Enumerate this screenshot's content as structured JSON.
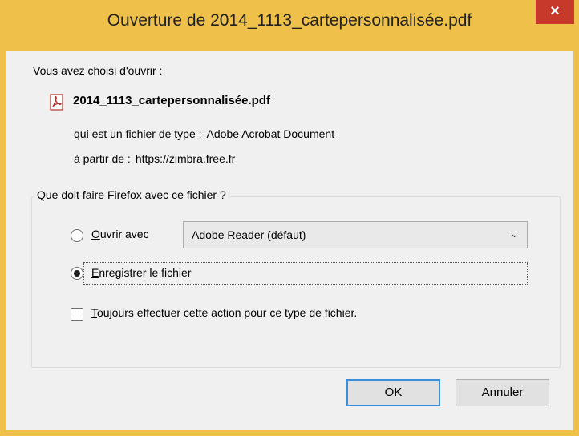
{
  "window": {
    "title": "Ouverture de 2014_1113_cartepersonnalisée.pdf",
    "close_label": "×"
  },
  "dialog": {
    "intro": "Vous avez choisi d'ouvrir :",
    "file_name": "2014_1113_cartepersonnalisée.pdf",
    "file_icon": "pdf-icon",
    "type_label": "qui est un fichier de type :",
    "type_value": "Adobe Acrobat Document",
    "from_label": "à partir de :",
    "from_value": "https://zimbra.free.fr"
  },
  "action_group": {
    "legend": "Que doit faire Firefox avec ce fichier ?",
    "open_with": {
      "mnemonic": "O",
      "rest": "uvrir avec",
      "selected": false,
      "app": "Adobe Reader  (défaut)"
    },
    "save_file": {
      "mnemonic": "E",
      "rest": "nregistrer le fichier",
      "selected": true
    },
    "always": {
      "mnemonic": "T",
      "rest": "oujours effectuer cette action pour ce type de fichier.",
      "checked": false
    }
  },
  "buttons": {
    "ok": "OK",
    "cancel": "Annuler"
  },
  "colors": {
    "titlebar": "#f0c14a",
    "close": "#c7392b",
    "dialog_bg": "#f0f0f0",
    "default_button_border": "#3c8ed8"
  }
}
